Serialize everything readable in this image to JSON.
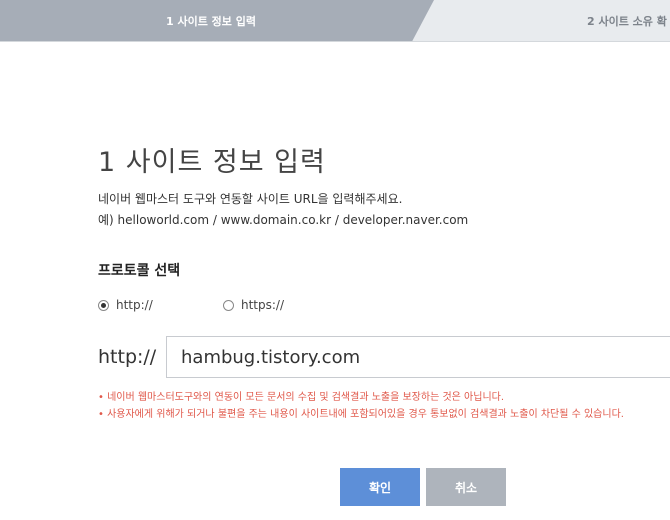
{
  "steps": {
    "active_label": "1 사이트 정보 입력",
    "next_label": "2 사이트 소유 확"
  },
  "main": {
    "title": "1 사이트 정보 입력",
    "description": "네이버 웹마스터 도구와 연동할 사이트 URL을 입력해주세요.",
    "example": "예) helloworld.com / www.domain.co.kr / developer.naver.com"
  },
  "protocol": {
    "title": "프로토콜 선택",
    "options": [
      {
        "label": "http://",
        "selected": true
      },
      {
        "label": "https://",
        "selected": false
      }
    ]
  },
  "url": {
    "prefix": "http://",
    "value": "hambug.tistory.com"
  },
  "notices": [
    "• 네이버 웹마스터도구와의 연동이 모든 문서의 수집 및 검색결과 노출을 보장하는 것은 아닙니다.",
    "• 사용자에게 위해가 되거나 불편을 주는 내용이 사이트내에 포함되어있을 경우 통보없이 검색결과 노출이 차단될 수 있습니다."
  ],
  "buttons": {
    "confirm": "확인",
    "cancel": "취소"
  },
  "colors": {
    "step_active": "#a6adb7",
    "confirm_button": "#5d8fd8",
    "cancel_button": "#aeb4bc",
    "notice_text": "#e0584a"
  }
}
